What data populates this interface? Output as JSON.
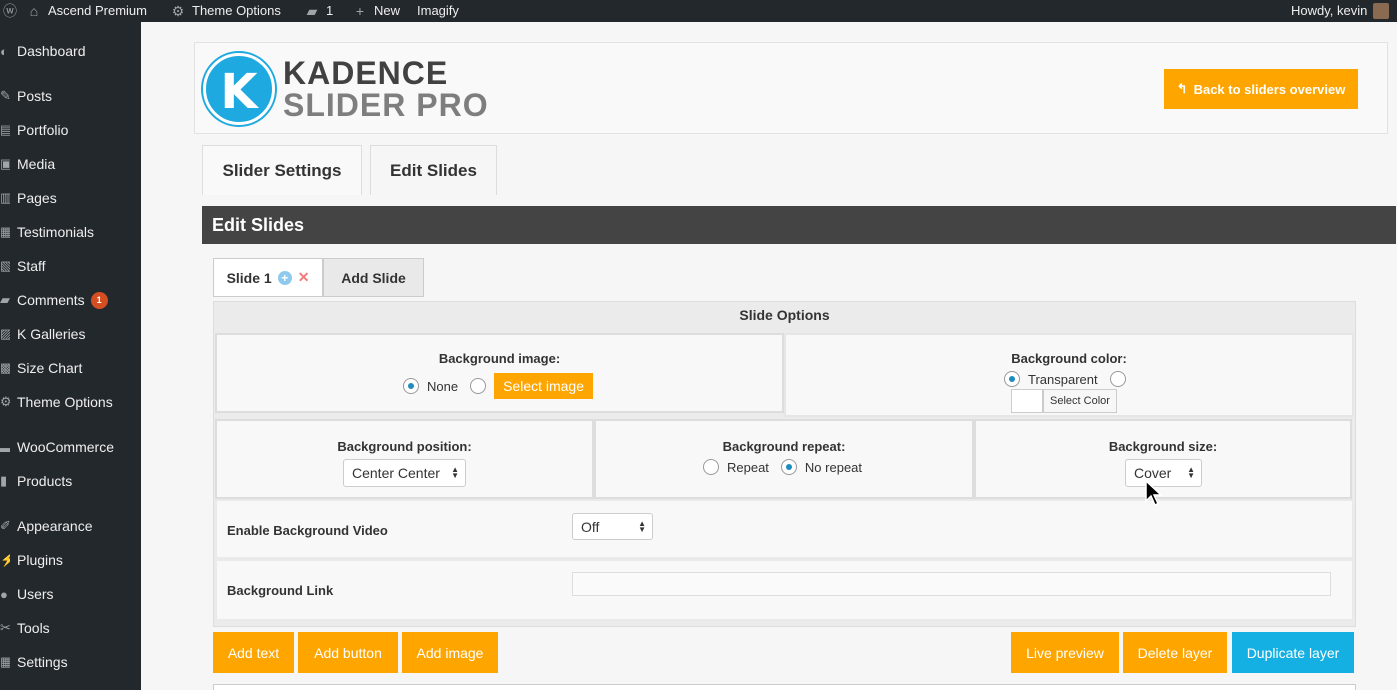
{
  "adminbar": {
    "site_name": "Ascend Premium",
    "theme_options": "Theme Options",
    "comments_count": "1",
    "new_label": "New",
    "imagify_label": "Imagify",
    "howdy": "Howdy, kevin"
  },
  "sidebar": {
    "items": [
      {
        "label": "Dashboard"
      },
      {
        "label": "Posts"
      },
      {
        "label": "Portfolio"
      },
      {
        "label": "Media"
      },
      {
        "label": "Pages"
      },
      {
        "label": "Testimonials"
      },
      {
        "label": "Staff"
      },
      {
        "label": "Comments",
        "badge": "1"
      },
      {
        "label": "K Galleries"
      },
      {
        "label": "Size Chart"
      },
      {
        "label": "Theme Options"
      },
      {
        "label": "WooCommerce"
      },
      {
        "label": "Products"
      },
      {
        "label": "Appearance"
      },
      {
        "label": "Plugins"
      },
      {
        "label": "Users"
      },
      {
        "label": "Tools"
      },
      {
        "label": "Settings"
      }
    ]
  },
  "header": {
    "logo_letter": "K",
    "logo_line1": "KADENCE",
    "logo_line2": "SLIDER PRO",
    "back_button": "Back to sliders overview"
  },
  "tabs": {
    "slider_settings": "Slider Settings",
    "edit_slides": "Edit Slides"
  },
  "edit_slides": {
    "title": "Edit Slides",
    "slide_tab": "Slide 1",
    "add_slide": "Add Slide",
    "options_title": "Slide Options",
    "background_image": {
      "label": "Background image:",
      "option_none": "None",
      "select_button": "Select image",
      "selected": "None"
    },
    "background_color": {
      "label": "Background color:",
      "option_transparent": "Transparent",
      "select_button": "Select Color",
      "selected": "Transparent"
    },
    "background_position": {
      "label": "Background position:",
      "value": "Center Center"
    },
    "background_repeat": {
      "label": "Background repeat:",
      "option_repeat": "Repeat",
      "option_no_repeat": "No repeat",
      "selected": "No repeat"
    },
    "background_size": {
      "label": "Background size:",
      "value": "Cover"
    },
    "background_video": {
      "label": "Enable Background Video",
      "value": "Off"
    },
    "background_link": {
      "label": "Background Link",
      "value": ""
    }
  },
  "actions": {
    "add_text": "Add text",
    "add_button": "Add button",
    "add_image": "Add image",
    "live_preview": "Live preview",
    "delete_layer": "Delete layer",
    "duplicate_layer": "Duplicate layer"
  },
  "colors": {
    "accent_orange": "#ffa500",
    "accent_blue": "#14b0e3",
    "admin_dark": "#23282d"
  }
}
